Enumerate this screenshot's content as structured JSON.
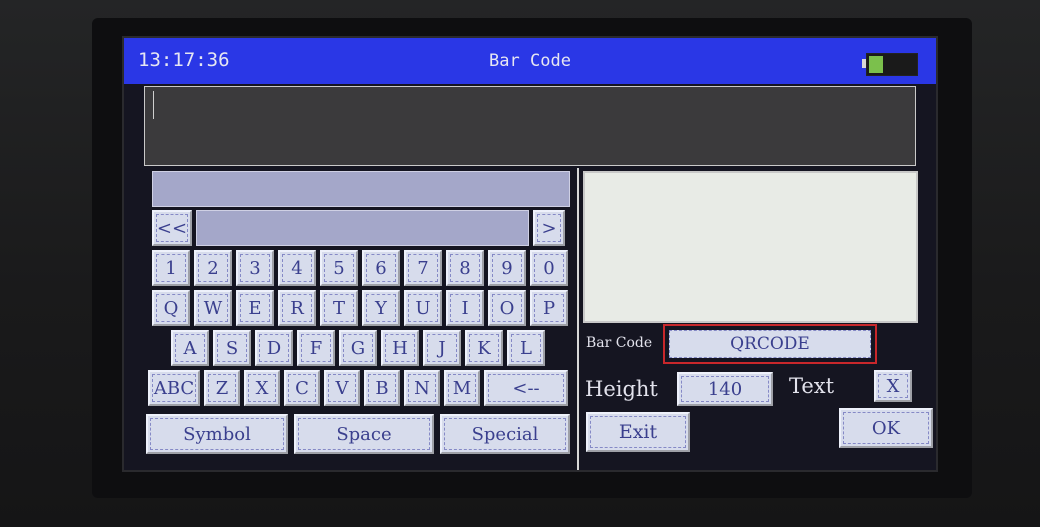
{
  "device": {
    "clock": "13:17:36",
    "title": "Bar Code",
    "battery_level": 0.3,
    "battery_color": "#7bc04c"
  },
  "text_input": {
    "value": ""
  },
  "keyboard": {
    "nav_prev": "<<",
    "nav_next": ">",
    "row_digits": [
      "1",
      "2",
      "3",
      "4",
      "5",
      "6",
      "7",
      "8",
      "9",
      "0"
    ],
    "row_qwerty": [
      "Q",
      "W",
      "E",
      "R",
      "T",
      "Y",
      "U",
      "I",
      "O",
      "P"
    ],
    "row_asdf": [
      "A",
      "S",
      "D",
      "F",
      "G",
      "H",
      "J",
      "K",
      "L"
    ],
    "row_zxcv": [
      "ABC",
      "Z",
      "X",
      "C",
      "V",
      "B",
      "N",
      "M",
      "<--"
    ],
    "bottom_row": [
      "Symbol",
      "Space",
      "Special"
    ]
  },
  "settings": {
    "bar_code_label": "Bar Code",
    "bar_code_value": "QRCODE",
    "height_label": "Height",
    "height_value": "140",
    "text_label": "Text",
    "text_toggle": "X",
    "exit_label": "Exit",
    "ok_label": "OK"
  },
  "colors": {
    "titlebar": "#2a37e6",
    "key_face": "#d7dcec",
    "key_text": "#3a3f8e",
    "selection_border": "#c8272b"
  }
}
